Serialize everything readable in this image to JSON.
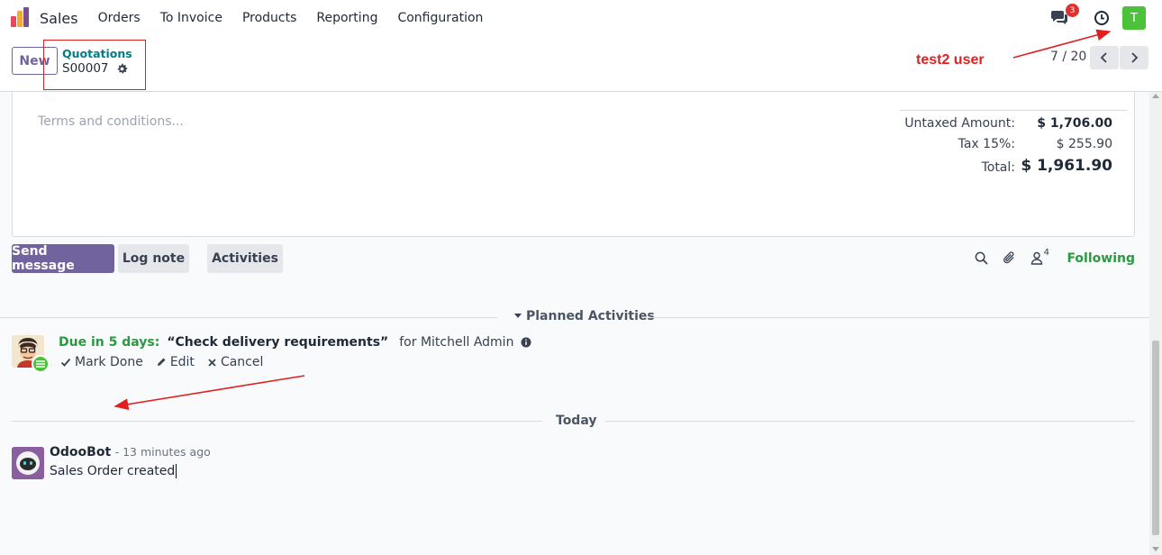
{
  "navbar": {
    "app_name": "Sales",
    "menu": [
      "Orders",
      "To Invoice",
      "Products",
      "Reporting",
      "Configuration"
    ],
    "messages_badge": "3",
    "user_initial": "T"
  },
  "control_panel": {
    "new_label": "New",
    "breadcrumb_parent": "Quotations",
    "breadcrumb_current": "S00007",
    "annotation_text": "test2 user",
    "pager_value": "7 / 20"
  },
  "form": {
    "terms_placeholder": "Terms and conditions...",
    "totals": [
      {
        "label": "Untaxed Amount:",
        "value": "$ 1,706.00"
      },
      {
        "label": "Tax 15%:",
        "value": "$ 255.90"
      },
      {
        "label": "Total:",
        "value": "$ 1,961.90"
      }
    ]
  },
  "chatter": {
    "send_message_label": "Send message",
    "log_note_label": "Log note",
    "activities_label": "Activities",
    "followers_count": "4",
    "following_label": "Following",
    "planned_activities_label": "Planned Activities",
    "activity": {
      "due": "Due in 5 days:",
      "title": "“Check delivery requirements”",
      "assignee": "for Mitchell Admin",
      "mark_done_label": "Mark Done",
      "edit_label": "Edit",
      "cancel_label": "Cancel"
    },
    "today_label": "Today",
    "message": {
      "author": "OdooBot",
      "time": "- 13 minutes ago",
      "body": "Sales Order created"
    }
  },
  "colors": {
    "primary": "#71639e",
    "following_green": "#2b9940",
    "annotation_red": "#e02020",
    "link_teal": "#017e84"
  }
}
